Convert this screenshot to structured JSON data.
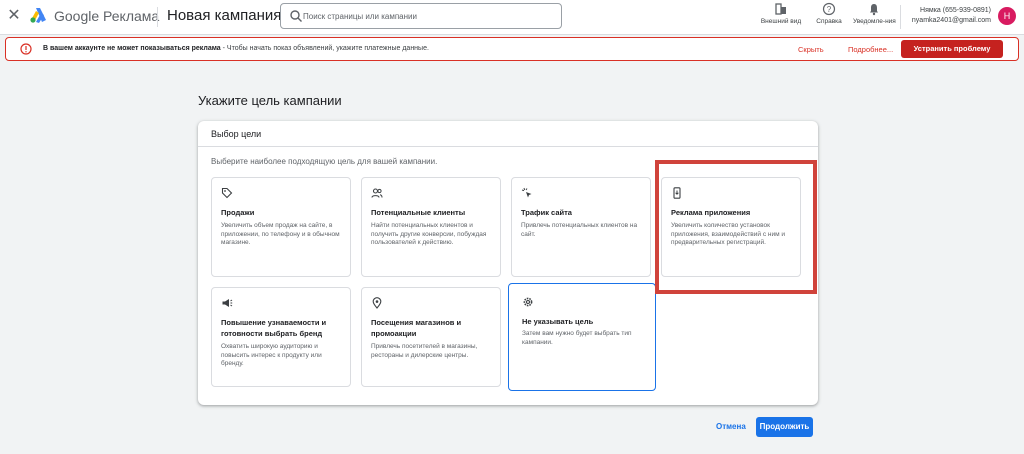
{
  "header": {
    "close_icon": "close-icon",
    "brand_google": "Google",
    "brand_product": "Реклама",
    "campaign_title": "Новая кампания",
    "search_placeholder": "Поиск страницы или кампании",
    "tools": {
      "view_label": "Внешний вид",
      "help_label": "Справка",
      "notifications_label": "Уведомле-ния"
    },
    "account": {
      "name": "Нямка (655-939-0891)",
      "email": "nyamka2401@gmail.com",
      "avatar_letter": "Н"
    }
  },
  "alert": {
    "bold_text": "В вашем аккаунте не может показываться реклама",
    "rest_text": " - Чтобы начать показ объявлений, укажите платежные данные.",
    "hide_label": "Скрыть",
    "more_label": "Подробнее...",
    "fix_label": "Устранить проблему",
    "accent_color": "#d93025"
  },
  "main": {
    "page_heading": "Укажите цель кампании",
    "panel_title": "Выбор цели",
    "panel_subtitle": "Выберите наиболее подходящую цель для вашей кампании.",
    "goals": [
      {
        "title": "Продажи",
        "description": "Увеличить объем продаж на сайте, в приложении, по телефону и в обычном магазине.",
        "icon": "tag-icon"
      },
      {
        "title": "Потенциальные клиенты",
        "description": "Найти потенциальных клиентов и получить другие конверсии, побуждая пользователей к действию.",
        "icon": "people-icon"
      },
      {
        "title": "Трафик сайта",
        "description": "Привлечь потенциальных клиентов на сайт.",
        "icon": "cursor-click-icon"
      },
      {
        "title": "Реклама приложения",
        "description": "Увеличить количество установок приложения, взаимодействий с ним и предварительных регистраций.",
        "icon": "phone-icon"
      },
      {
        "title": "Повышение узнаваемости и готовности выбрать бренд",
        "description": "Охватить широкую аудиторию и повысить интерес к продукту или бренду.",
        "icon": "megaphone-icon"
      },
      {
        "title": "Посещения магазинов и промоакции",
        "description": "Привлечь посетителей в магазины, рестораны и дилерские центры.",
        "icon": "location-pin-icon"
      },
      {
        "title": "Не указывать цель",
        "description": "Затем вам нужно будет выбрать тип кампании.",
        "icon": "gear-icon"
      }
    ],
    "selected_goal": "Не указывать цель",
    "cancel_label": "Отмена",
    "continue_label": "Продолжить",
    "primary_color": "#1a73e8"
  }
}
